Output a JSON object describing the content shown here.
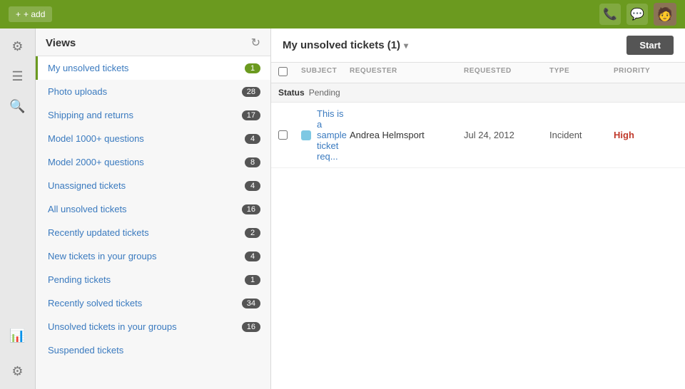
{
  "topbar": {
    "add_label": "+ add",
    "phone_icon": "📞",
    "chat_icon": "💬",
    "avatar_icon": "👤"
  },
  "sidebar_icons": [
    {
      "name": "settings-icon",
      "glyph": "⚙",
      "label": "Settings"
    },
    {
      "name": "menu-icon",
      "glyph": "☰",
      "label": "Menu"
    },
    {
      "name": "search-icon",
      "glyph": "🔍",
      "label": "Search"
    },
    {
      "name": "reports-icon",
      "glyph": "📊",
      "label": "Reports"
    },
    {
      "name": "admin-icon",
      "glyph": "⚙",
      "label": "Admin"
    }
  ],
  "views": {
    "title": "Views",
    "items": [
      {
        "label": "My unsolved tickets",
        "count": "1",
        "badge_class": "green",
        "active": true
      },
      {
        "label": "Photo uploads",
        "count": "28",
        "badge_class": ""
      },
      {
        "label": "Shipping and returns",
        "count": "17",
        "badge_class": ""
      },
      {
        "label": "Model 1000+ questions",
        "count": "4",
        "badge_class": ""
      },
      {
        "label": "Model 2000+ questions",
        "count": "8",
        "badge_class": ""
      },
      {
        "label": "Unassigned tickets",
        "count": "4",
        "badge_class": ""
      },
      {
        "label": "All unsolved tickets",
        "count": "16",
        "badge_class": ""
      },
      {
        "label": "Recently updated tickets",
        "count": "2",
        "badge_class": ""
      },
      {
        "label": "New tickets in your groups",
        "count": "4",
        "badge_class": ""
      },
      {
        "label": "Pending tickets",
        "count": "1",
        "badge_class": ""
      },
      {
        "label": "Recently solved tickets",
        "count": "34",
        "badge_class": ""
      },
      {
        "label": "Unsolved tickets in your groups",
        "count": "16",
        "badge_class": ""
      },
      {
        "label": "Suspended tickets",
        "count": "",
        "badge_class": ""
      }
    ]
  },
  "main": {
    "title": "My unsolved tickets (1)",
    "start_label": "Start",
    "columns": [
      "Subject",
      "Requester",
      "Requested",
      "Type",
      "Priority"
    ],
    "status_label": "Status",
    "status_value": "Pending",
    "tickets": [
      {
        "subject": "This is a sample ticket req...",
        "requester": "Andrea Helmsport",
        "requested": "Jul 24, 2012",
        "type": "Incident",
        "priority": "High"
      }
    ]
  }
}
